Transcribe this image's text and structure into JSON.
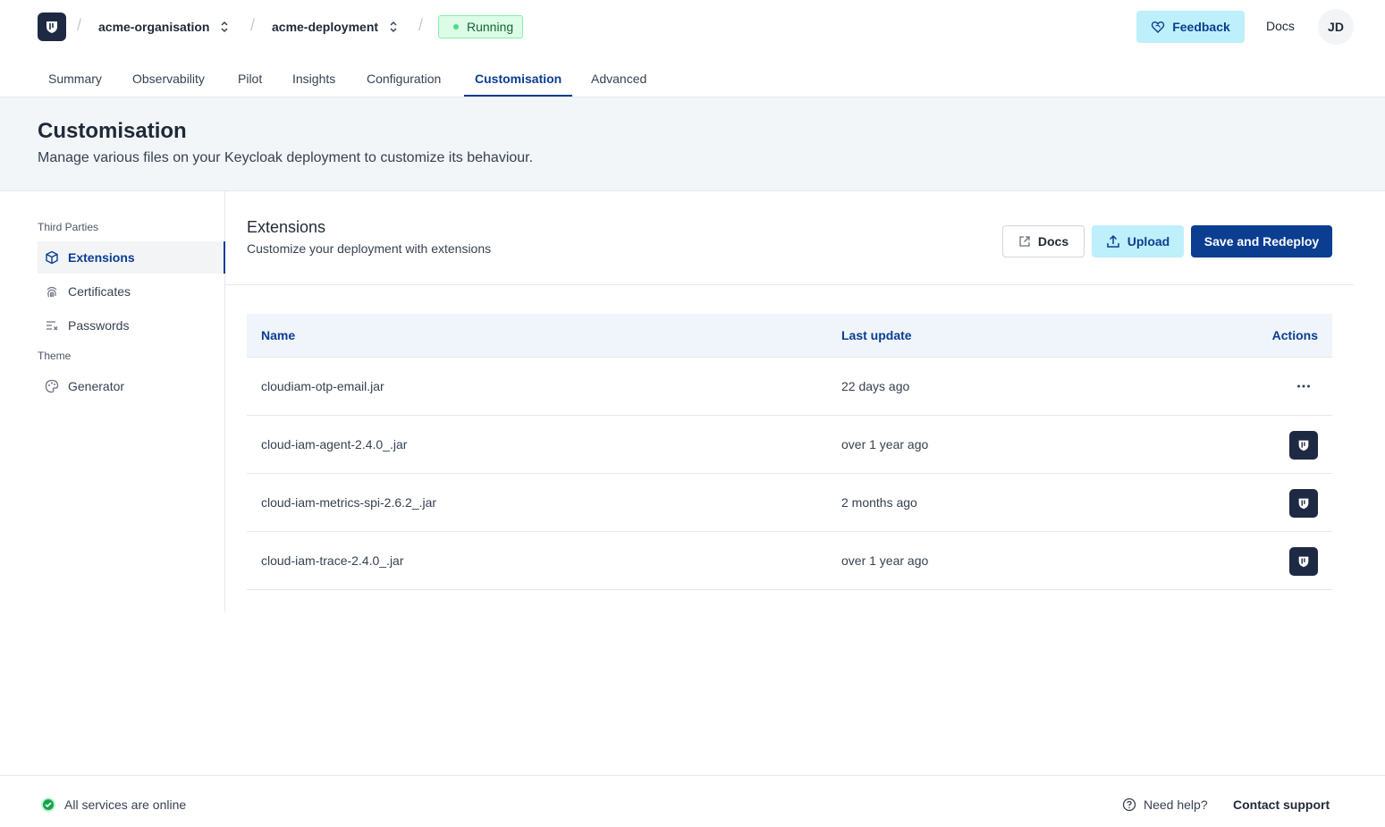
{
  "header": {
    "organisation": "acme-organisation",
    "deployment": "acme-deployment",
    "status": "Running",
    "feedback_label": "Feedback",
    "docs_label": "Docs",
    "avatar_initials": "JD"
  },
  "tabs": [
    {
      "label": "Summary"
    },
    {
      "label": "Observability"
    },
    {
      "label": "Pilot"
    },
    {
      "label": "Insights"
    },
    {
      "label": "Configuration"
    },
    {
      "label": "Customisation",
      "active": true
    },
    {
      "label": "Advanced"
    }
  ],
  "page": {
    "title": "Customisation",
    "subtitle": "Manage various files on your Keycloak deployment to customize its behaviour."
  },
  "sidebar": {
    "groups": [
      {
        "label": "Third Parties",
        "items": [
          {
            "label": "Extensions",
            "icon": "cube-icon",
            "active": true
          },
          {
            "label": "Certificates",
            "icon": "fingerprint-icon"
          },
          {
            "label": "Passwords",
            "icon": "text-clear-icon"
          }
        ]
      },
      {
        "label": "Theme",
        "items": [
          {
            "label": "Generator",
            "icon": "palette-icon"
          }
        ]
      }
    ]
  },
  "section": {
    "title": "Extensions",
    "subtitle": "Customize your deployment with extensions",
    "docs_label": "Docs",
    "upload_label": "Upload",
    "save_label": "Save and Redeploy"
  },
  "table": {
    "columns": [
      "Name",
      "Last update",
      "Actions"
    ],
    "rows": [
      {
        "name": "cloudiam-otp-email.jar",
        "updated": "22 days ago",
        "action": "more-dots"
      },
      {
        "name": "cloud-iam-agent-2.4.0_.jar",
        "updated": "over 1 year ago",
        "action": "cloud-iam-logo"
      },
      {
        "name": "cloud-iam-metrics-spi-2.6.2_.jar",
        "updated": "2 months ago",
        "action": "cloud-iam-logo"
      },
      {
        "name": "cloud-iam-trace-2.4.0_.jar",
        "updated": "over 1 year ago",
        "action": "cloud-iam-logo"
      }
    ]
  },
  "footer": {
    "status_text": "All services are online",
    "help_label": "Need help?",
    "contact_label": "Contact support"
  },
  "colors": {
    "brand_dark": "#1e2a44",
    "accent": "#0b3d91",
    "accent_light": "#bdf0fa",
    "status_green": "#4ade80"
  }
}
